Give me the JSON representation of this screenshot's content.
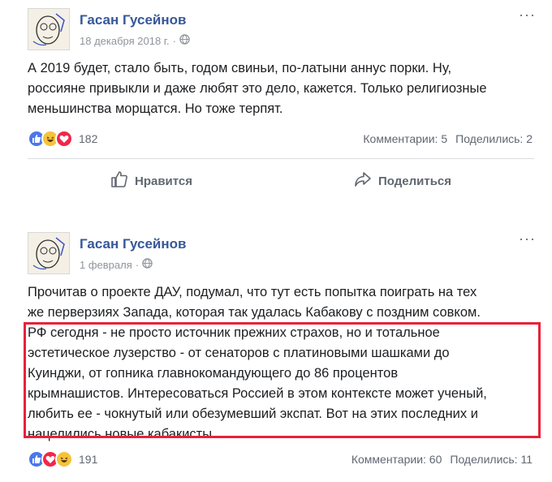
{
  "post1": {
    "author": "Гасан Гусейнов",
    "date": "18 декабря 2018 г.",
    "date_sep": "·",
    "text_lines": [
      "А 2019 будет, стало быть, годом свиньи, по-латыни аннус порки. Ну,",
      "россияне привыкли и даже любят это дело, кажется. Только религиозные",
      "меньшинства морщатся. Но тоже терпят."
    ],
    "reactions": [
      "like",
      "haha",
      "love"
    ],
    "reaction_count": "182",
    "comments": "Комментарии: 5",
    "shares": "Поделились: 2",
    "like_label": "Нравится",
    "share_label": "Поделиться"
  },
  "post2": {
    "author": "Гасан Гусейнов",
    "date": "1 февраля",
    "date_sep": "·",
    "text_lines": [
      "Прочитав о проекте ДАУ, подумал, что тут есть попытка поиграть на тех",
      "же перверзиях Запада, которая так удалась Кабакову с поздним совком.",
      "РФ сегодня - не просто источник прежних страхов, но и тотальное",
      "эстетическое лузерство - от сенаторов с платиновыми шашками до",
      "Куинджи, от гопника главнокомандующего до 86 процентов",
      "крымнашистов. Интересоваться Россией в этом контексте может ученый,",
      "любить ее - чокнутый или обезумевший экспат. Вот на этих последних и",
      "нацелились новые кабакисты."
    ],
    "reactions": [
      "like",
      "love",
      "haha"
    ],
    "reaction_count": "191",
    "comments": "Комментарии: 60",
    "shares": "Поделились: 11"
  },
  "colors": {
    "author": "#365899",
    "highlight_border": "#e8213a",
    "like": "#4a78e8",
    "love": "#f0284a",
    "haha": "#f5c33b"
  },
  "icons": [
    "globe-icon",
    "more-options-icon",
    "like-reaction-icon",
    "haha-reaction-icon",
    "love-reaction-icon",
    "thumbs-up-icon",
    "share-arrow-icon"
  ]
}
